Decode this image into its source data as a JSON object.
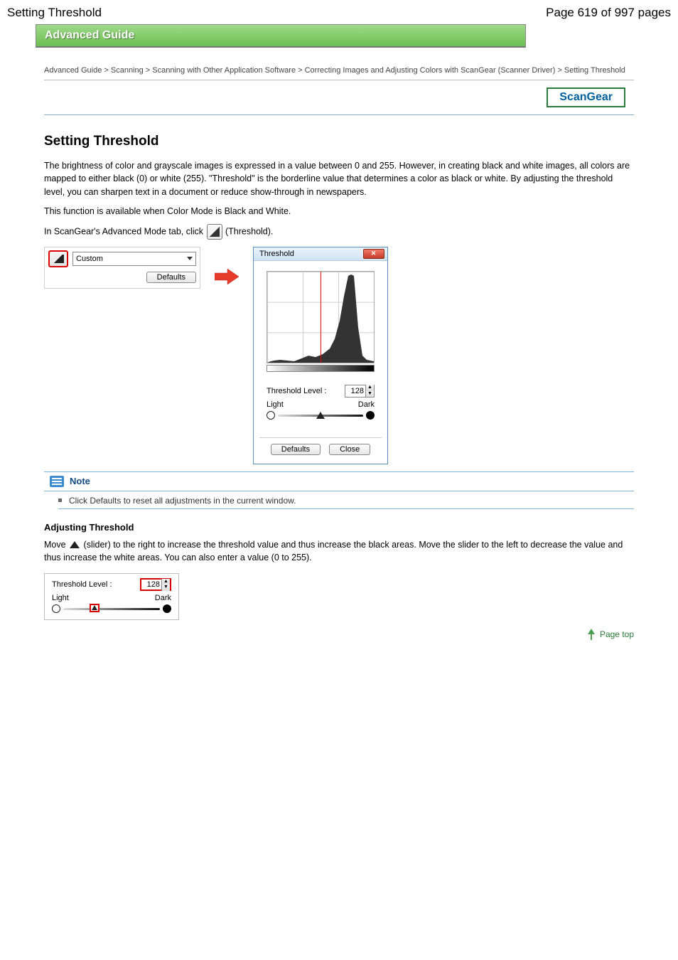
{
  "header": {
    "left": "Setting Threshold",
    "right": "Page 619 of 997 pages"
  },
  "banner": "Advanced Guide",
  "breadcrumb": "Advanced Guide > Scanning > Scanning with Other Application Software > Correcting Images and Adjusting Colors with ScanGear (Scanner Driver) > Setting Threshold",
  "scangear": "ScanGear",
  "title": "Setting Threshold",
  "para1": "The brightness of color and grayscale images is expressed in a value between 0 and 255. However, in creating black and white images, all colors are mapped to either black (0) or white (255). \"Threshold\" is the borderline value that determines a color as black or white. By adjusting the threshold level, you can sharpen text in a document or reduce show-through in newspapers.",
  "para2": "This function is available when Color Mode is Black and White.",
  "para3_a": "In ScanGear's Advanced Mode tab, click ",
  "para3_b": " (Threshold).",
  "left_panel": {
    "dropdown_value": "Custom",
    "defaults": "Defaults"
  },
  "dialog": {
    "title": "Threshold",
    "level_label": "Threshold Level :",
    "level_value": "128",
    "light": "Light",
    "dark": "Dark",
    "defaults": "Defaults",
    "close": "Close"
  },
  "note": {
    "head": "Note",
    "item": "Click Defaults to reset all adjustments in the current window."
  },
  "section": {
    "head": "Adjusting Threshold",
    "para_a": "Move ",
    "para_b": " (slider) to the right to increase the threshold value and thus increase the black areas. Move the slider to the left to decrease the value and thus increase the white areas. You can also enter a value (0 to 255).",
    "fig": {
      "level_label": "Threshold Level :",
      "level_value": "128",
      "light": "Light",
      "dark": "Dark"
    }
  },
  "pagetop": "Page top"
}
